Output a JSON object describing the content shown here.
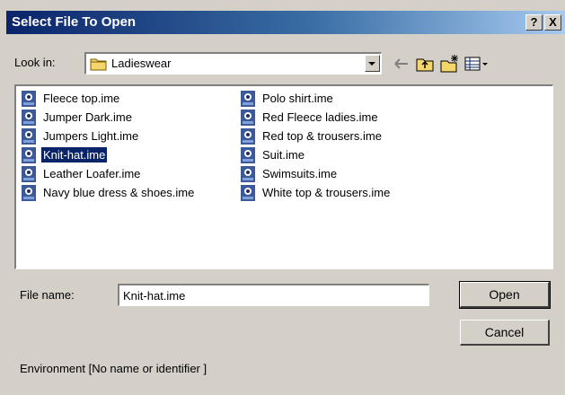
{
  "window": {
    "title": "Select File To Open",
    "help_label": "?",
    "close_label": "X"
  },
  "look_in": {
    "label": "Look in:",
    "value": "Ladieswear"
  },
  "toolbar": {
    "back_icon": "back-arrow-icon",
    "up_icon": "up-one-level-icon",
    "new_folder_icon": "new-folder-icon",
    "view_menu_icon": "view-menu-icon"
  },
  "files": {
    "col1": [
      {
        "name": "Fleece top.ime"
      },
      {
        "name": "Jumper Dark.ime"
      },
      {
        "name": "Jumpers Light.ime"
      },
      {
        "name": "Knit-hat.ime"
      },
      {
        "name": "Leather Loafer.ime"
      },
      {
        "name": "Navy blue dress & shoes.ime"
      }
    ],
    "col2": [
      {
        "name": "Polo shirt.ime"
      },
      {
        "name": "Red Fleece ladies.ime"
      },
      {
        "name": "Red top & trousers.ime"
      },
      {
        "name": "Suit.ime"
      },
      {
        "name": "Swimsuits.ime"
      },
      {
        "name": "White top & trousers.ime"
      }
    ],
    "selected": "Knit-hat.ime"
  },
  "file_name": {
    "label": "File name:",
    "value": "Knit-hat.ime"
  },
  "buttons": {
    "open": "Open",
    "cancel": "Cancel"
  },
  "environment": {
    "text": "Environment [No name or identifier        ]"
  },
  "colors": {
    "title_bar": "#0a246a",
    "selection": "#0a246a",
    "face": "#d4d0c8"
  }
}
